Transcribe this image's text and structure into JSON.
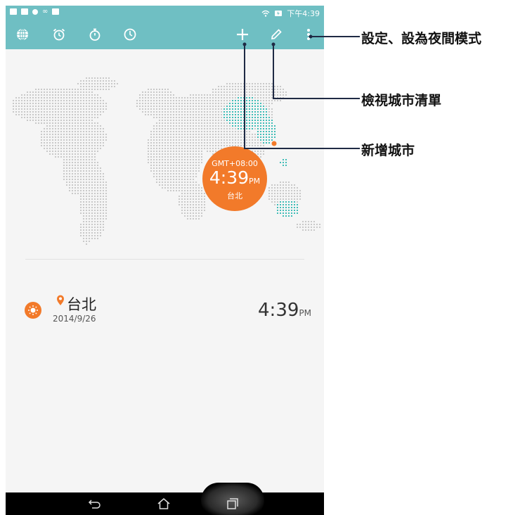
{
  "status_bar": {
    "time": "下午4:39",
    "left_icons": [
      "sd-card-icon",
      "calendar-icon",
      "cloud-icon",
      "voicemail-icon",
      "screenshot-icon"
    ],
    "right_icons": [
      "wifi-icon",
      "battery-charging-icon"
    ]
  },
  "toolbar": {
    "tabs": [
      {
        "name": "world-clock-tab",
        "icon": "globe-icon"
      },
      {
        "name": "alarm-tab",
        "icon": "alarm-clock-icon"
      },
      {
        "name": "stopwatch-tab",
        "icon": "stopwatch-icon"
      },
      {
        "name": "timer-tab",
        "icon": "timer-icon"
      }
    ],
    "actions": [
      {
        "name": "add-city-button",
        "icon": "plus-icon"
      },
      {
        "name": "edit-city-list-button",
        "icon": "pencil-icon"
      },
      {
        "name": "more-options-button",
        "icon": "overflow-menu-icon"
      }
    ]
  },
  "map_overlay": {
    "gmt": "GMT+08:00",
    "time": "4:39",
    "ampm": "PM",
    "city": "台北"
  },
  "city_list": [
    {
      "name": "台北",
      "date": "2014/9/26",
      "time": "4:39",
      "ampm": "PM",
      "icon": "sun-icon"
    }
  ],
  "annotations": [
    {
      "label": "設定、設為夜間模式"
    },
    {
      "label": "檢視城市清單"
    },
    {
      "label": "新增城市"
    }
  ],
  "colors": {
    "accent": "#6fbfc3",
    "orange": "#f27a2a",
    "map_dot": "#c9c9c9",
    "map_highlight": "#3fbdb7"
  },
  "nav_bar": {
    "buttons": [
      "back-icon",
      "home-icon",
      "recent-apps-icon"
    ]
  }
}
